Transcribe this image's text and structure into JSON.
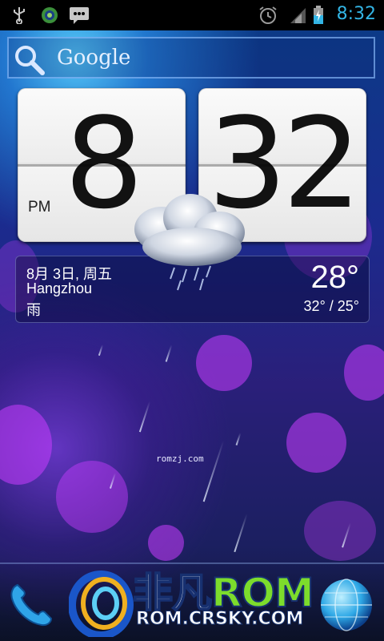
{
  "status_bar": {
    "time": "8:32",
    "icons": [
      "usb-icon",
      "app-circle-icon",
      "message-icon",
      "alarm-clock-icon",
      "signal-icon",
      "battery-charging-icon"
    ]
  },
  "search": {
    "label": "Google"
  },
  "clock": {
    "hour": "8",
    "minute": "32",
    "ampm": "PM"
  },
  "weather": {
    "date": "8月 3日, 周五",
    "city": "Hangzhou",
    "condition": "雨",
    "temperature": "28°",
    "range": "32° / 25°"
  },
  "watermark": {
    "small": "romzj.com",
    "brand_cn": "非凡",
    "brand_en": "ROM",
    "url": "ROM.CRSKY.COM"
  },
  "colors": {
    "accent": "#33b5e5",
    "brand_green": "#7ddc2c"
  }
}
